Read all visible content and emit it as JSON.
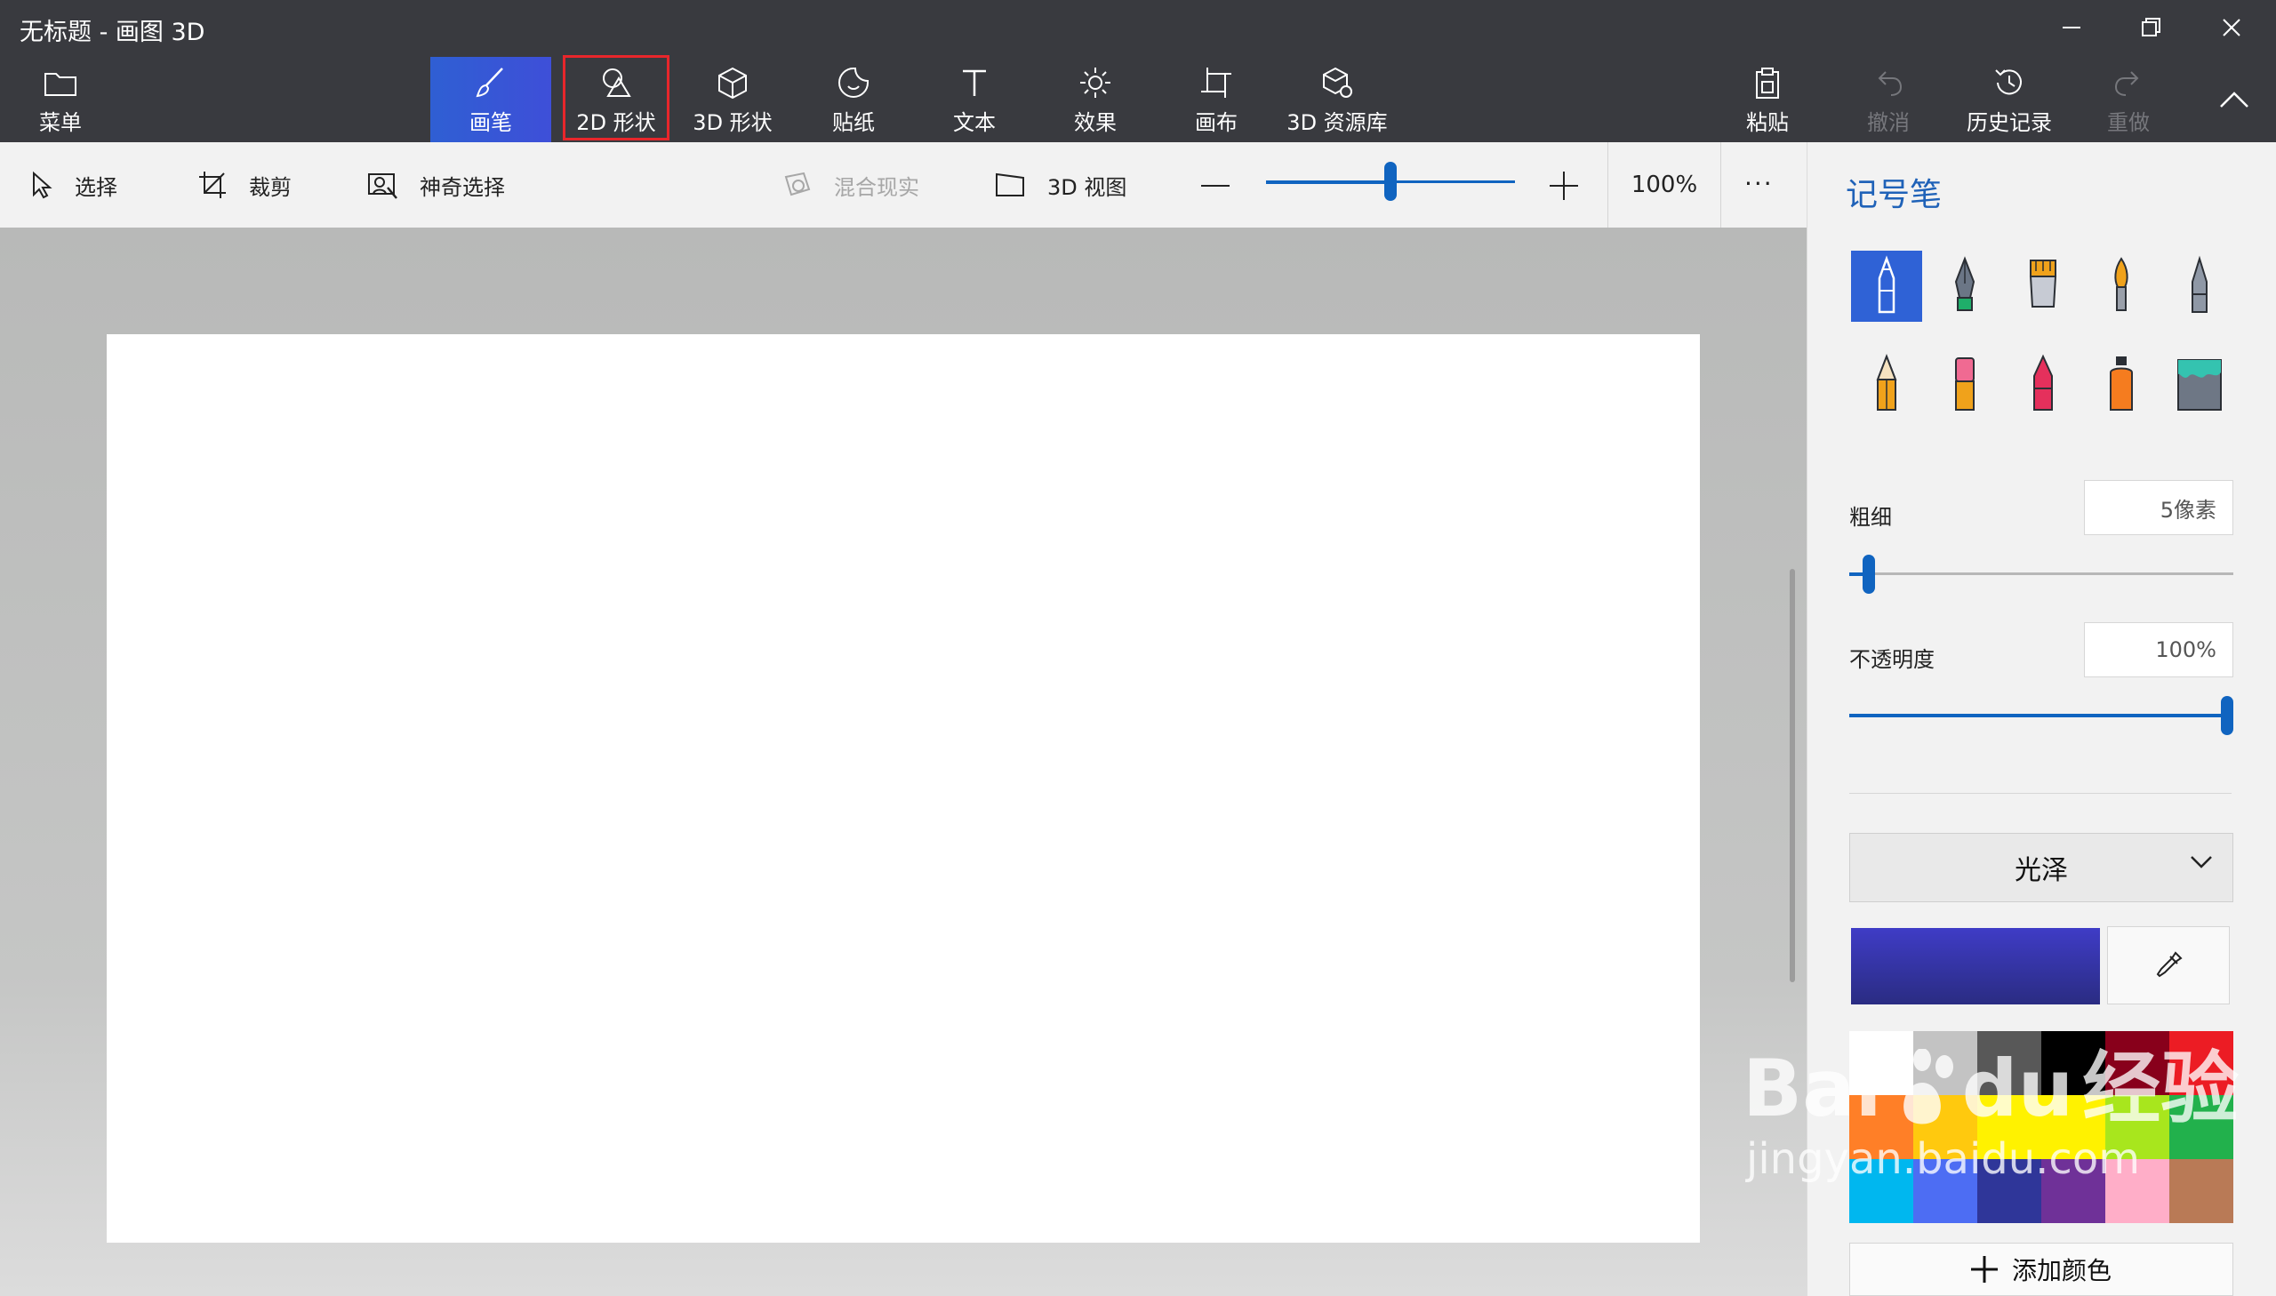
{
  "window": {
    "title": "无标题 - 画图 3D"
  },
  "ribbon": {
    "menu": "菜单",
    "brushes": "画笔",
    "shapes_2d": "2D 形状",
    "shapes_3d": "3D 形状",
    "stickers": "贴纸",
    "text": "文本",
    "effects": "效果",
    "canvas": "画布",
    "library_3d": "3D 资源库",
    "paste": "粘贴",
    "undo": "撤消",
    "history": "历史记录",
    "redo": "重做"
  },
  "toolbar": {
    "select": "选择",
    "crop": "裁剪",
    "magic_select": "神奇选择",
    "mixed_reality": "混合现实",
    "view_3d": "3D 视图",
    "zoom_percent": "100%",
    "zoom_level": 0.5,
    "more": "···"
  },
  "panel": {
    "title": "记号笔",
    "brush_tools": [
      "marker-icon",
      "calligraphy-pen-icon",
      "oil-brush-icon",
      "watercolor-icon",
      "pixel-pen-icon",
      "pencil-icon",
      "eraser-icon",
      "crayon-icon",
      "spray-can-icon",
      "fill-bucket-icon"
    ],
    "selected_brush_index": 0,
    "thickness_label": "粗细",
    "thickness_value": "5像素",
    "thickness_level": 0.05,
    "opacity_label": "不透明度",
    "opacity_value": "100%",
    "opacity_level": 1.0,
    "finish_value": "光泽",
    "current_color": "#3f3cc6",
    "palette": [
      "#ffffff",
      "#c3c3c3",
      "#585858",
      "#000000",
      "#88001b",
      "#ec1c24",
      "#ff7f27",
      "#ffc90e",
      "#fff200",
      "#fff200",
      "#a8e61d",
      "#22b14c",
      "#00b7ef",
      "#4d6df3",
      "#2f3699",
      "#6f3198",
      "#ffaec8",
      "#b97a56"
    ],
    "add_color": "添加颜色"
  },
  "watermark": {
    "brand": "Bai",
    "brand2": "du",
    "cn": "经验",
    "url": "jingyan.baidu.com"
  },
  "colors": {
    "titlebar": "#393a3f",
    "accent": "#1064c0",
    "highlight": "#e8262b"
  }
}
